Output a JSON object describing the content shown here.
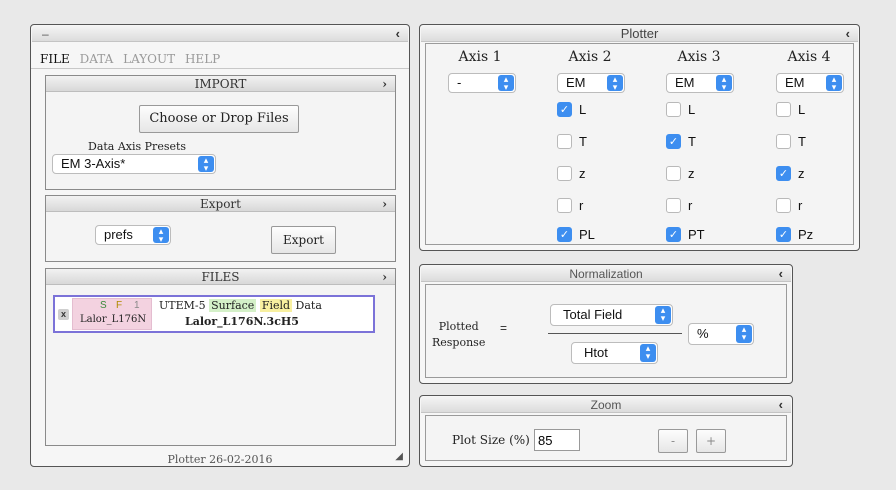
{
  "left": {
    "window_dash": "–",
    "menu": [
      "FILE",
      "DATA",
      "LAYOUT",
      "HELP"
    ],
    "import": {
      "header": "IMPORT",
      "choose_button": "Choose or Drop Files",
      "presets_label": "Data Axis Presets",
      "preset_value": "EM 3-Axis*"
    },
    "export": {
      "header": "Export",
      "prefs_value": "prefs",
      "export_button": "Export"
    },
    "files": {
      "header": "FILES",
      "item": {
        "close": "x",
        "tag_s": "S",
        "tag_f": "F",
        "tag_num": "1",
        "name": "Lalor_L176N",
        "desc_prefix": "UTEM-5",
        "desc_surface": "Surface",
        "desc_field": "Field",
        "desc_suffix": "Data",
        "filename": "Lalor_L176N.3cH5"
      }
    },
    "footer": "Plotter 26-02-2016"
  },
  "plotter": {
    "title": "Plotter",
    "axes": [
      {
        "header": "Axis 1",
        "value": "-",
        "checks": []
      },
      {
        "header": "Axis 2",
        "value": "EM",
        "checks": [
          {
            "label": "L",
            "checked": true
          },
          {
            "label": "T",
            "checked": false
          },
          {
            "label": "z",
            "checked": false
          },
          {
            "label": "r",
            "checked": false
          },
          {
            "label": "PL",
            "checked": true
          }
        ]
      },
      {
        "header": "Axis 3",
        "value": "EM",
        "checks": [
          {
            "label": "L",
            "checked": false
          },
          {
            "label": "T",
            "checked": true
          },
          {
            "label": "z",
            "checked": false
          },
          {
            "label": "r",
            "checked": false
          },
          {
            "label": "PT",
            "checked": true
          }
        ]
      },
      {
        "header": "Axis 4",
        "value": "EM",
        "checks": [
          {
            "label": "L",
            "checked": false
          },
          {
            "label": "T",
            "checked": false
          },
          {
            "label": "z",
            "checked": true
          },
          {
            "label": "r",
            "checked": false
          },
          {
            "label": "Pz",
            "checked": true
          }
        ]
      }
    ]
  },
  "normalization": {
    "title": "Normalization",
    "label_line1": "Plotted",
    "label_line2": "Response",
    "equals": "=",
    "numerator": "Total Field",
    "denominator": "Htot",
    "unit": "%"
  },
  "zoom": {
    "title": "Zoom",
    "label": "Plot Size (%)",
    "value": "85",
    "minus": "-",
    "plus": "+"
  }
}
